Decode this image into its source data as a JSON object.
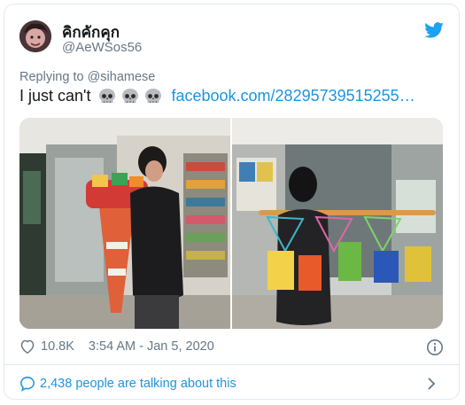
{
  "author": {
    "display_name": "คิกคักคุก",
    "handle": "@AeWSos56"
  },
  "reply": {
    "prefix": "Replying to",
    "to": "@sihamese"
  },
  "tweet": {
    "text": "I just can't",
    "link": "facebook.com/28295739515255…"
  },
  "stats": {
    "likes": "10.8K",
    "timestamp": "3:54 AM - Jan 5, 2020"
  },
  "conversation": {
    "label": "2,438 people are talking about this"
  },
  "icons": {
    "brand": "twitter-bird-icon",
    "emoji": "skull-icon",
    "like": "heart-icon",
    "info": "info-icon",
    "talk": "speech-bubble-icon",
    "chevron": "chevron-right-icon"
  },
  "colors": {
    "link": "#1b95e0",
    "secondary": "#657786",
    "text": "#14171a",
    "border": "#e1e8ed"
  }
}
